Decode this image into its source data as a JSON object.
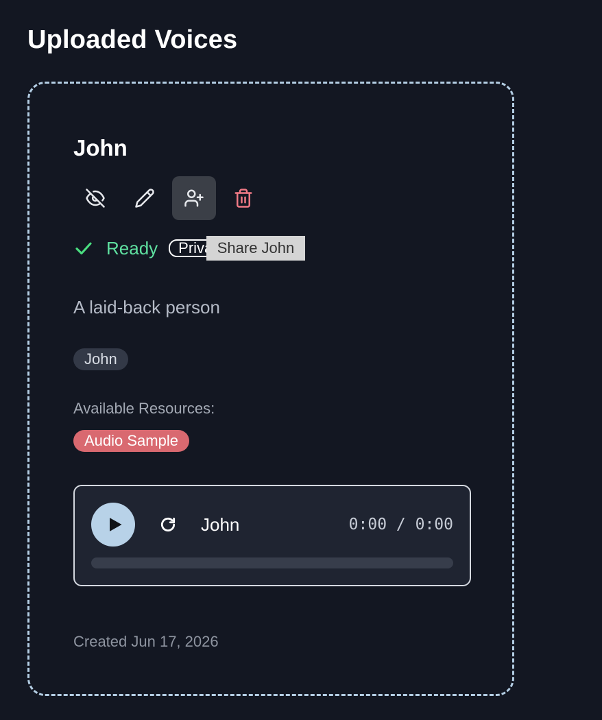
{
  "page": {
    "title": "Uploaded Voices"
  },
  "voice": {
    "name": "John",
    "actions": [
      {
        "name": "hide",
        "icon": "eye-off-icon",
        "color": "#e6e8ec"
      },
      {
        "name": "edit",
        "icon": "pencil-icon",
        "color": "#e6e8ec"
      },
      {
        "name": "share",
        "icon": "user-plus-icon",
        "color": "#e6e8ec",
        "active": true
      },
      {
        "name": "delete",
        "icon": "trash-icon",
        "color": "#f07a86"
      }
    ],
    "status": {
      "label": "Ready",
      "icon": "check-icon",
      "color": "#5fe0a0"
    },
    "privacy": "Private",
    "tooltip": "Share John",
    "description": "A laid-back person",
    "tags": [
      "John"
    ],
    "resources_label": "Available Resources:",
    "resources": [
      {
        "label": "Audio Sample",
        "color": "#d96970"
      }
    ],
    "player": {
      "play_icon": "play-icon",
      "replay_icon": "replay-icon",
      "track_name": "John",
      "time": "0:00 / 0:00",
      "progress": 0
    },
    "created": "Created Jun 17, 2026"
  }
}
